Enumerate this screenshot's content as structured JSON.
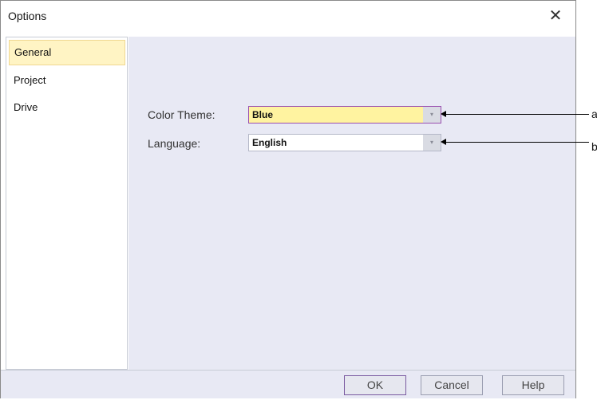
{
  "window": {
    "title": "Options",
    "close_glyph": "✕",
    "close_icon": "close-icon"
  },
  "sidebar": {
    "items": [
      {
        "label": "General",
        "selected": true
      },
      {
        "label": "Project",
        "selected": false
      },
      {
        "label": "Drive",
        "selected": false
      }
    ]
  },
  "settings": {
    "color_theme": {
      "label": "Color Theme:",
      "value": "Blue",
      "arrow": "▾"
    },
    "language": {
      "label": "Language:",
      "value": "English",
      "arrow": "▾"
    }
  },
  "buttons": {
    "ok": "OK",
    "cancel": "Cancel",
    "help": "Help"
  },
  "callouts": {
    "a": "a",
    "b": "b"
  },
  "colors": {
    "selected_item_bg": "#fff4c4",
    "active_combo_bg": "#fff3a0",
    "panel_bg": "#e8e9f4",
    "focus_border": "#9a4fb0"
  }
}
